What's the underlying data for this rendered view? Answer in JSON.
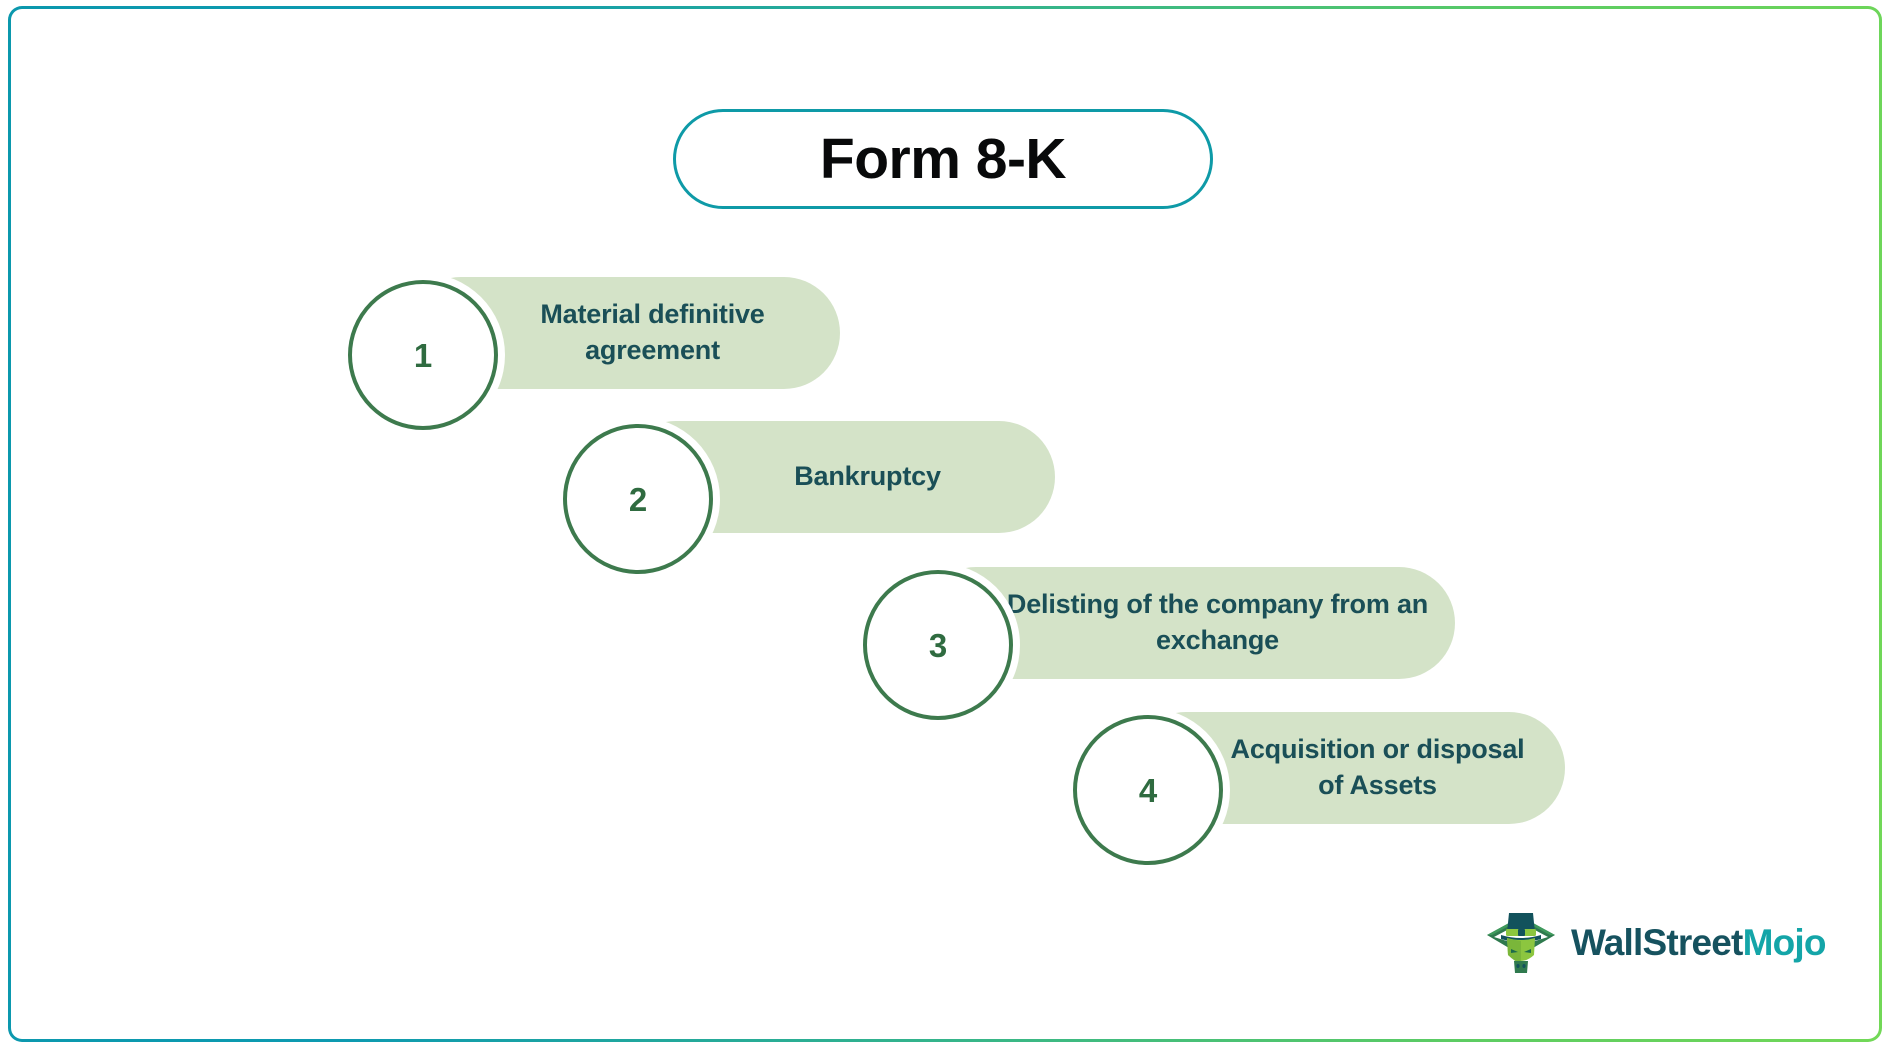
{
  "card": {
    "border_gradient_start": "#0b98ad",
    "border_gradient_end": "#72d857",
    "background": "#ffffff"
  },
  "title": {
    "text": "Form 8-K",
    "text_color": "#08090a",
    "border_color": "#0e9aa7"
  },
  "steps": [
    {
      "number": "1",
      "label": "Material definitive agreement",
      "pill_color": "#d4e3c8",
      "text_color": "#1a4f57",
      "circle_color": "#3d7a4d"
    },
    {
      "number": "2",
      "label": "Bankruptcy",
      "pill_color": "#d4e3c8",
      "text_color": "#1a4f57",
      "circle_color": "#3d7a4d"
    },
    {
      "number": "3",
      "label": "Delisting of the company from an exchange",
      "pill_color": "#d4e3c8",
      "text_color": "#1a4f57",
      "circle_color": "#3d7a4d"
    },
    {
      "number": "4",
      "label": "Acquisition or disposal of Assets",
      "pill_color": "#d4e3c8",
      "text_color": "#1a4f57",
      "circle_color": "#3d7a4d"
    }
  ],
  "logo": {
    "icon": "bull-mascot-tophat-icon",
    "word_primary": "WallStreet",
    "word_accent": "Mojo",
    "primary_color": "#16525f",
    "accent_color": "#14a5a8"
  }
}
